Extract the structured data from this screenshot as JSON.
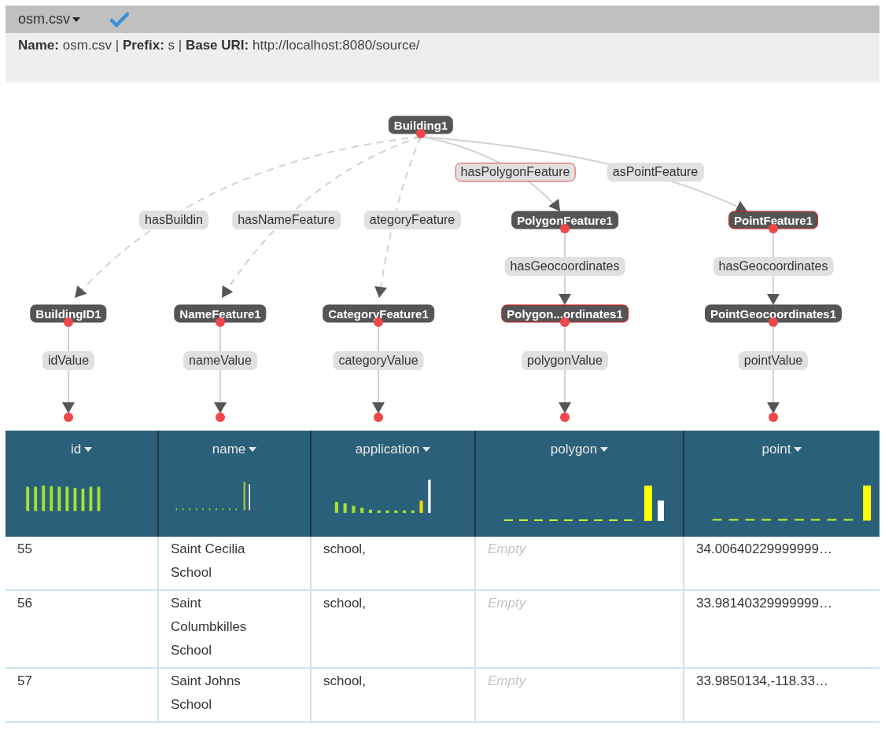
{
  "source_bar": {
    "menu_label": "osm.csv",
    "published": true,
    "info": "**Name:** osm.csv | **Prefix:** s | **Base URI:** http://localhost:8080/source/"
  },
  "graph": {
    "nodes": [
      {
        "label": "Building1",
        "highlighted": false
      },
      {
        "label": "PolygonFeature1",
        "highlighted": false
      },
      {
        "label": "PointFeature1",
        "highlighted": true
      },
      {
        "label": "BuildingID1",
        "highlighted": false
      },
      {
        "label": "NameFeature1",
        "highlighted": false
      },
      {
        "label": "CategoryFeature1",
        "highlighted": false
      },
      {
        "label": "Polygon...ordinates1",
        "highlighted": true
      },
      {
        "label": "PointGeocoordinates1",
        "highlighted": false
      }
    ],
    "edges": [
      {
        "label": "hasBuildin",
        "dashed": true,
        "highlighted": false
      },
      {
        "label": "hasNameFeature",
        "dashed": true,
        "highlighted": false
      },
      {
        "label": "ategoryFeature",
        "dashed": true,
        "highlighted": false
      },
      {
        "label": "hasPolygonFeature",
        "dashed": false,
        "highlighted": true
      },
      {
        "label": "asPointFeature",
        "dashed": false,
        "highlighted": false
      },
      {
        "label": "hasGeocoordinates",
        "dashed": false,
        "highlighted": false
      },
      {
        "label": "hasGeocoordinates",
        "dashed": false,
        "highlighted": false
      },
      {
        "label": "idValue",
        "dashed": false,
        "highlighted": false
      },
      {
        "label": "nameValue",
        "dashed": false,
        "highlighted": false
      },
      {
        "label": "categoryValue",
        "dashed": false,
        "highlighted": false
      },
      {
        "label": "polygonValue",
        "dashed": false,
        "highlighted": false
      },
      {
        "label": "pointValue",
        "dashed": false,
        "highlighted": false
      }
    ]
  },
  "table": {
    "columns": [
      "id",
      "name",
      "application",
      "polygon",
      "point"
    ],
    "rows": [
      {
        "cells": [
          {
            "text": "55",
            "empty": false
          },
          {
            "text": "Saint Cecilia School",
            "empty": false
          },
          {
            "text": "school,",
            "empty": false
          },
          {
            "text": "Empty",
            "empty": true
          },
          {
            "text": "34.00640229999999…",
            "empty": false
          }
        ]
      },
      {
        "cells": [
          {
            "text": "56",
            "empty": false
          },
          {
            "text": "Saint Columbkilles School",
            "empty": false
          },
          {
            "text": "school,",
            "empty": false
          },
          {
            "text": "Empty",
            "empty": true
          },
          {
            "text": "33.98140329999999…",
            "empty": false
          }
        ]
      },
      {
        "cells": [
          {
            "text": "57",
            "empty": false
          },
          {
            "text": "Saint Johns School",
            "empty": false
          },
          {
            "text": "school,",
            "empty": false
          },
          {
            "text": "Empty",
            "empty": true
          },
          {
            "text": "33.9850134,-118.33…",
            "empty": false
          }
        ]
      }
    ]
  }
}
